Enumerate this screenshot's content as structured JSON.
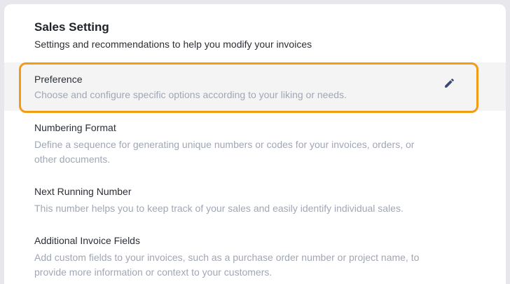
{
  "header": {
    "title": "Sales Setting",
    "subtitle": "Settings and recommendations to help you modify your invoices"
  },
  "settings": [
    {
      "title": "Preference",
      "description": "Choose and configure specific options according to your liking or needs.",
      "selected": true,
      "action_icon": "pencil-icon"
    },
    {
      "title": "Numbering Format",
      "description": "Define a sequence for generating unique numbers or codes for your invoices, orders, or other documents."
    },
    {
      "title": "Next Running Number",
      "description": "This number helps you to keep track of your sales and easily identify individual sales."
    },
    {
      "title": "Additional Invoice Fields",
      "description": "Add custom fields to your invoices, such as a purchase order number or project name, to provide more information or context to your customers."
    }
  ],
  "colors": {
    "highlight": "#f29b16",
    "icon": "#3a4a75",
    "description": "#a0a7b4"
  }
}
